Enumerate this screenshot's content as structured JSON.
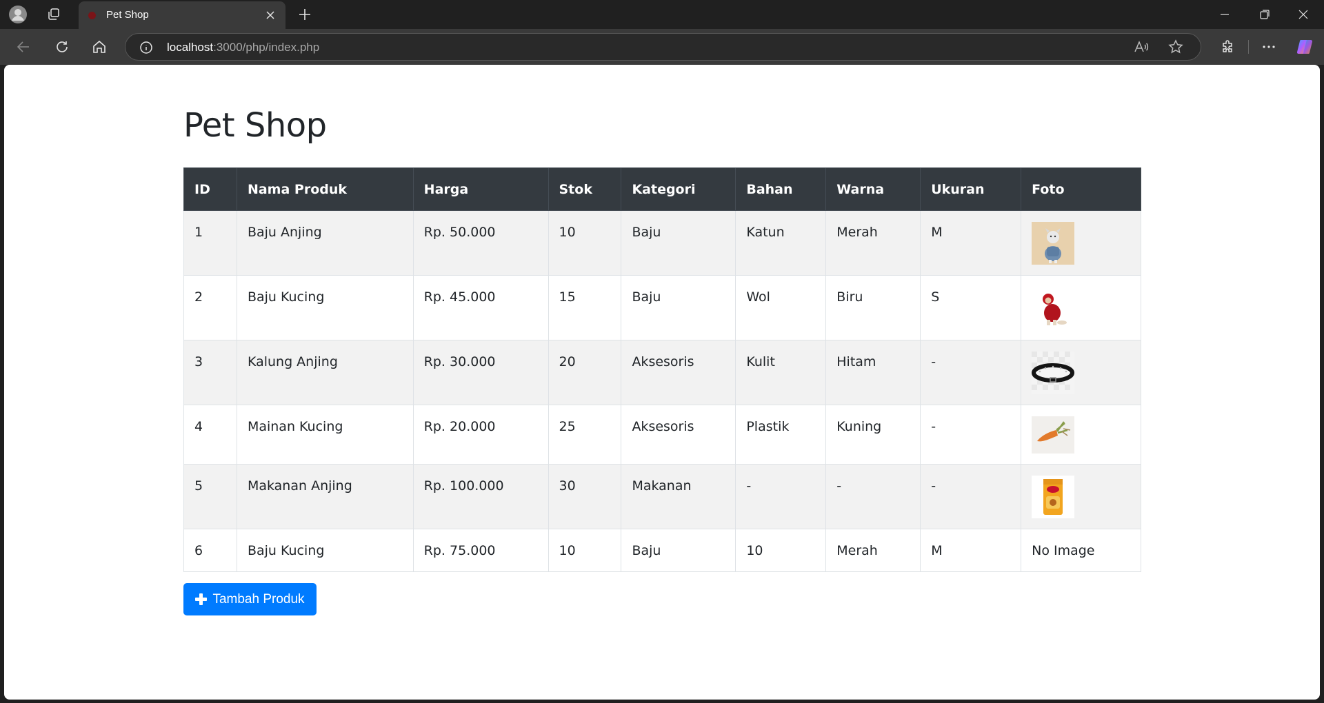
{
  "browser": {
    "tab_title": "Pet Shop",
    "url_host": "localhost",
    "url_rest": ":3000/php/index.php",
    "favicon_color": "#7a1418"
  },
  "page": {
    "title": "Pet Shop",
    "add_button_label": "Tambah Produk"
  },
  "table": {
    "columns": [
      "ID",
      "Nama Produk",
      "Harga",
      "Stok",
      "Kategori",
      "Bahan",
      "Warna",
      "Ukuran",
      "Foto"
    ],
    "rows": [
      {
        "id": "1",
        "name": "Baju Anjing",
        "price": "Rp. 50.000",
        "stock": "10",
        "category": "Baju",
        "material": "Katun",
        "color": "Merah",
        "size": "M",
        "photo": "dog-in-denim-jacket-thumbnail"
      },
      {
        "id": "2",
        "name": "Baju Kucing",
        "price": "Rp. 45.000",
        "stock": "15",
        "category": "Baju",
        "material": "Wol",
        "color": "Biru",
        "size": "S",
        "photo": "cat-in-red-hoodie-thumbnail"
      },
      {
        "id": "3",
        "name": "Kalung Anjing",
        "price": "Rp. 30.000",
        "stock": "20",
        "category": "Aksesoris",
        "material": "Kulit",
        "color": "Hitam",
        "size": "-",
        "photo": "black-studded-collar-thumbnail"
      },
      {
        "id": "4",
        "name": "Mainan Kucing",
        "price": "Rp. 20.000",
        "stock": "25",
        "category": "Aksesoris",
        "material": "Plastik",
        "color": "Kuning",
        "size": "-",
        "photo": "carrot-cat-toy-thumbnail"
      },
      {
        "id": "5",
        "name": "Makanan Anjing",
        "price": "Rp. 100.000",
        "stock": "30",
        "category": "Makanan",
        "material": "-",
        "color": "-",
        "size": "-",
        "photo": "dog-food-bag-thumbnail"
      },
      {
        "id": "6",
        "name": "Baju Kucing",
        "price": "Rp. 75.000",
        "stock": "10",
        "category": "Baju",
        "material": "10",
        "color": "Merah",
        "size": "M",
        "photo_text": "No Image"
      }
    ]
  },
  "colors": {
    "header_bg": "#343a40",
    "stripe_bg": "#f2f2f2",
    "button_bg": "#007bff"
  }
}
